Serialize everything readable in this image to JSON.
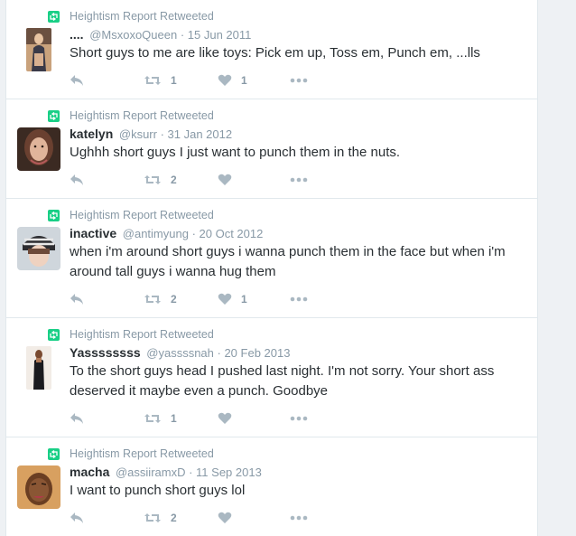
{
  "tweets": [
    {
      "retweet_label": "Heightism Report Retweeted",
      "fullname": "....",
      "handle": "@MsxoxoQueen",
      "date": "· 15 Jun 2011",
      "text": "Short guys to me are like toys: Pick em up, Toss em, Punch em,  ...lls",
      "retweets": "1",
      "likes": "1"
    },
    {
      "retweet_label": "Heightism Report Retweeted",
      "fullname": "katelyn",
      "handle": "@ksurr",
      "date": "· 31 Jan 2012",
      "text": "Ughhh short guys I just want to punch them in the nuts.",
      "retweets": "2",
      "likes": ""
    },
    {
      "retweet_label": "Heightism Report Retweeted",
      "fullname": "inactive",
      "handle": "@antimyung",
      "date": "· 20 Oct 2012",
      "text": "when i'm around short guys i wanna punch them in the face but when i'm around tall guys i wanna hug them",
      "retweets": "2",
      "likes": "1"
    },
    {
      "retweet_label": "Heightism Report Retweeted",
      "fullname": "Yassssssss",
      "handle": "@yassssnah",
      "date": "· 20 Feb 2013",
      "text": "To the short guys head I pushed last night. I'm not sorry. Your short ass deserved it maybe even a punch. Goodbye",
      "retweets": "1",
      "likes": ""
    },
    {
      "retweet_label": "Heightism Report Retweeted",
      "fullname": "macha",
      "handle": "@assiiramxD",
      "date": "· 11 Sep 2013",
      "text": "I want to punch short guys lol",
      "retweets": "2",
      "likes": ""
    }
  ],
  "colors": {
    "retweet_green": "#19cf86",
    "icon_gray": "#aab8c2",
    "meta_gray": "#8899a6",
    "text_dark": "#292f33"
  }
}
